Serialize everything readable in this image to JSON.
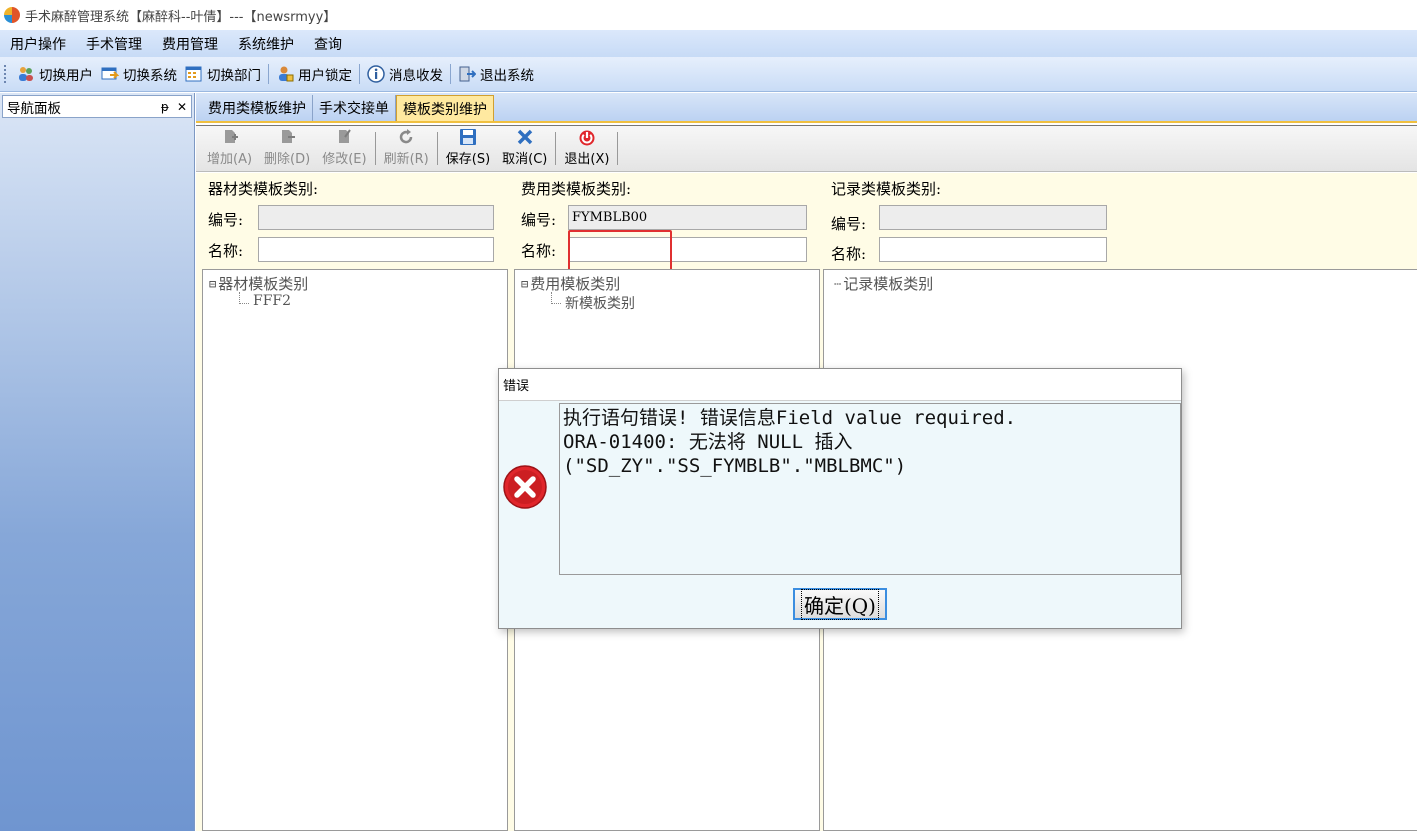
{
  "window": {
    "title": "手术麻醉管理系统【麻醉科--叶倩】---【newsrmyy】"
  },
  "menu": [
    "用户操作",
    "手术管理",
    "费用管理",
    "系统维护",
    "查询"
  ],
  "toolbar": [
    {
      "label": "切换用户",
      "icon": "users-icon"
    },
    {
      "label": "切换系统",
      "icon": "switch-system-icon"
    },
    {
      "label": "切换部门",
      "icon": "department-icon"
    },
    {
      "label": "用户锁定",
      "icon": "user-lock-icon"
    },
    {
      "label": "消息收发",
      "icon": "info-icon"
    },
    {
      "label": "退出系统",
      "icon": "exit-icon"
    }
  ],
  "nav": {
    "title": "导航面板",
    "pin": "ᵽ",
    "close": "✕"
  },
  "tabs": [
    {
      "label": "费用类模板维护",
      "active": false
    },
    {
      "label": "手术交接单",
      "active": false
    },
    {
      "label": "模板类别维护",
      "active": true
    }
  ],
  "actions": [
    {
      "label": "增加(A)",
      "enabled": false
    },
    {
      "label": "删除(D)",
      "enabled": false
    },
    {
      "label": "修改(E)",
      "enabled": false
    },
    {
      "label": "刷新(R)",
      "enabled": false
    },
    {
      "label": "保存(S)",
      "enabled": true
    },
    {
      "label": "取消(C)",
      "enabled": true
    },
    {
      "label": "退出(X)",
      "enabled": true
    }
  ],
  "panels": {
    "equipment": {
      "title": "器材类模板类别:",
      "code_label": "编号:",
      "code_value": "",
      "name_label": "名称:",
      "name_value": "",
      "tree_root": "器材模板类别",
      "tree_child": "FFF2"
    },
    "fee": {
      "title": "费用类模板类别:",
      "code_label": "编号:",
      "code_value": "FYMBLB00",
      "name_label": "名称:",
      "name_value": "",
      "tree_root": "费用模板类别",
      "tree_child": "新模板类别"
    },
    "record": {
      "title": "记录类模板类别:",
      "code_label": "编号:",
      "code_value": "",
      "name_label": "名称:",
      "name_value": "",
      "tree_root": "记录模板类别"
    }
  },
  "dialog": {
    "title": "错误",
    "message": "执行语句错误! 错误信息Field value required.\nORA-01400: 无法将 NULL 插入\n(\"SD_ZY\".\"SS_FYMBLB\".\"MBLBMC\")",
    "ok_label": "确定(Q)"
  },
  "colors": {
    "error_red": "#e0262b",
    "highlight": "#e03030",
    "tab_active": "#ffe9a0"
  }
}
